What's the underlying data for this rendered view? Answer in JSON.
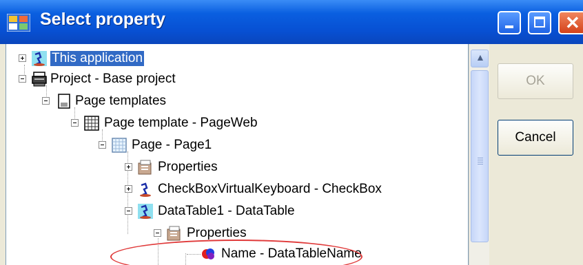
{
  "window": {
    "title": "Select property"
  },
  "tree": {
    "items": [
      {
        "label": "This application",
        "state": "collapsed",
        "icon": "application-icon",
        "selected": true
      },
      {
        "label": "Project - Base project",
        "state": "expanded",
        "icon": "project-icon"
      },
      {
        "label": "Page templates",
        "state": "expanded",
        "icon": "page-templates-icon"
      },
      {
        "label": "Page template - PageWeb",
        "state": "expanded",
        "icon": "page-template-icon"
      },
      {
        "label": "Page - Page1",
        "state": "expanded",
        "icon": "page-icon"
      },
      {
        "label": "Properties",
        "state": "collapsed",
        "icon": "properties-icon"
      },
      {
        "label": "CheckBoxVirtualKeyboard - CheckBox",
        "state": "collapsed",
        "icon": "checkbox-control-icon"
      },
      {
        "label": "DataTable1 - DataTable",
        "state": "expanded",
        "icon": "datatable-control-icon",
        "highlighted": true
      },
      {
        "label": "Properties",
        "state": "expanded",
        "icon": "properties-icon"
      },
      {
        "label": "Name - DataTableName",
        "state": "leaf",
        "icon": "property-value-icon"
      }
    ]
  },
  "buttons": {
    "ok_label": "OK",
    "cancel_label": "Cancel"
  },
  "colors": {
    "selection": "#316ac5",
    "highlight_ellipse": "#e03a3a",
    "titlebar": "#0a5fe0"
  }
}
